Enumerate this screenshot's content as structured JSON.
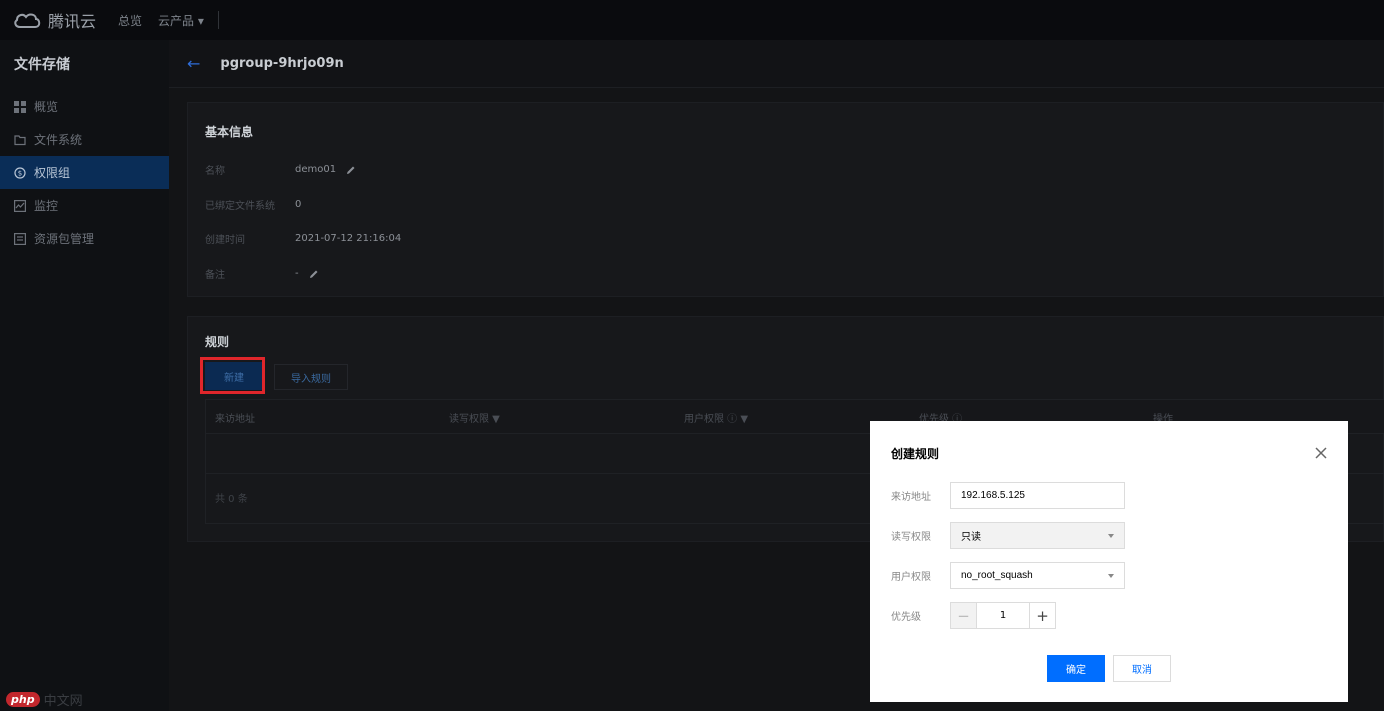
{
  "topbar": {
    "brand": "腾讯云",
    "nav_overview": "总览",
    "nav_products": "云产品 ▾"
  },
  "sidebar": {
    "title": "文件存储",
    "items": [
      {
        "label": "概览",
        "icon": "grid-icon"
      },
      {
        "label": "文件系统",
        "icon": "folder-icon"
      },
      {
        "label": "权限组",
        "icon": "permission-icon",
        "active": true
      },
      {
        "label": "监控",
        "icon": "monitor-icon"
      },
      {
        "label": "资源包管理",
        "icon": "package-icon"
      }
    ],
    "watermark_badge": "php",
    "watermark_text": "中文网"
  },
  "page": {
    "title": "pgroup-9hrjo09n"
  },
  "basic_info": {
    "title": "基本信息",
    "rows": [
      {
        "label": "名称",
        "value": "demo01"
      },
      {
        "label": "已绑定文件系统",
        "value": "0"
      },
      {
        "label": "创建时间",
        "value": "2021-07-12 21:16:04"
      },
      {
        "label": "备注",
        "value": "-"
      }
    ]
  },
  "rules": {
    "title": "规则",
    "new_button": "新建",
    "import_button": "导入规则",
    "columns": [
      "来访地址",
      "读写权限 ▼",
      "用户权限 ⓘ ▼",
      "优先级 ⓘ",
      "操作"
    ],
    "footer": "共 0 条"
  },
  "modal": {
    "title": "创建规则",
    "fields": {
      "address_label": "来访地址",
      "address_value": "192.168.5.125",
      "rw_label": "读写权限",
      "rw_value": "只读",
      "user_label": "用户权限",
      "user_value": "no_root_squash",
      "priority_label": "优先级",
      "priority_value": "1"
    },
    "confirm": "确定",
    "cancel": "取消"
  },
  "colors": {
    "primary": "#006eff",
    "highlight": "#e0262b",
    "sidebar_active": "#0a2d57"
  }
}
